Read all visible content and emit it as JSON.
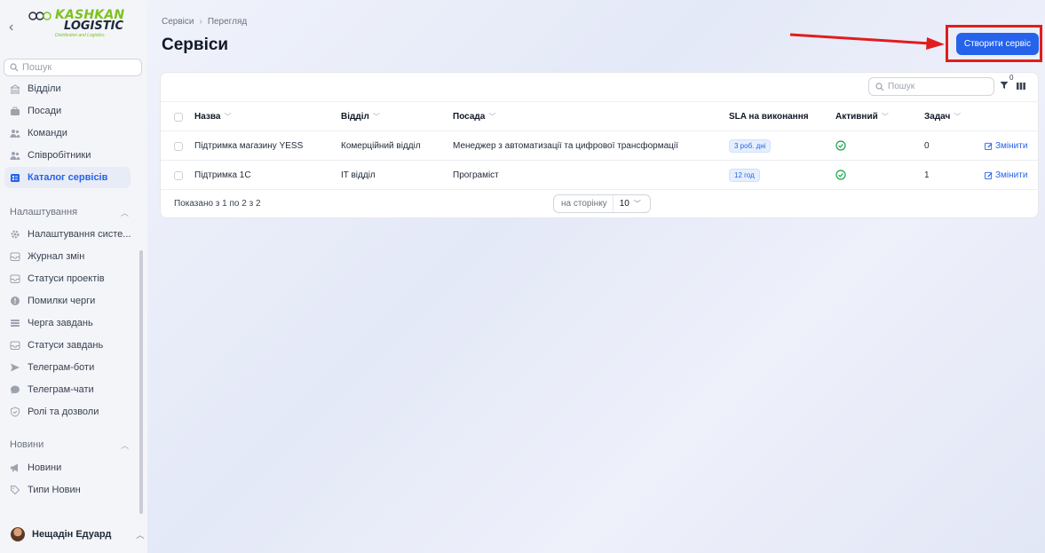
{
  "sidebar": {
    "logo_line1": "KASHKAN",
    "logo_line2": "LOGISTIC",
    "logo_tagline": "Distribution and Logistics",
    "search_placeholder": "Пошук",
    "items": [
      {
        "label": "Відділи",
        "icon": "building-icon"
      },
      {
        "label": "Посади",
        "icon": "briefcase-icon"
      },
      {
        "label": "Команди",
        "icon": "users-icon"
      },
      {
        "label": "Співробітники",
        "icon": "users-icon"
      },
      {
        "label": "Каталог сервісів",
        "icon": "catalog-icon",
        "active": true
      }
    ],
    "settings_group": "Налаштування",
    "settings_items": [
      {
        "label": "Налаштування систе...",
        "icon": "gear-icon"
      },
      {
        "label": "Журнал змін",
        "icon": "inbox-icon"
      },
      {
        "label": "Статуси проектів",
        "icon": "inbox-icon"
      },
      {
        "label": "Помилки черги",
        "icon": "alert-icon"
      },
      {
        "label": "Черга завдань",
        "icon": "queue-icon"
      },
      {
        "label": "Статуси завдань",
        "icon": "inbox-icon"
      },
      {
        "label": "Телеграм-боти",
        "icon": "send-icon"
      },
      {
        "label": "Телеграм-чати",
        "icon": "chat-icon"
      },
      {
        "label": "Ролі та дозволи",
        "icon": "shield-icon"
      }
    ],
    "news_group": "Новини",
    "news_items": [
      {
        "label": "Новини",
        "icon": "megaphone-icon"
      },
      {
        "label": "Типи Новин",
        "icon": "tag-icon"
      }
    ],
    "user_name": "Нещадін Едуард"
  },
  "header": {
    "breadcrumb": [
      "Сервіси",
      "Перегляд"
    ],
    "breadcrumb_sep": "›",
    "title": "Сервіси",
    "create_button": "Створити сервіс"
  },
  "table": {
    "search_placeholder": "Пошук",
    "filter_count": "0",
    "columns": [
      "Назва",
      "Відділ",
      "Посада",
      "SLA на виконання",
      "Активний",
      "Задач"
    ],
    "rows": [
      {
        "name": "Підтримка магазину YESS",
        "dept": "Комерційний відділ",
        "position": "Менеджер з автоматизації та цифрової трансформації",
        "sla": "3 роб. дні",
        "active": true,
        "tasks": "0",
        "edit": "Змінити"
      },
      {
        "name": "Підтримка 1С",
        "dept": "IT відділ",
        "position": "Програміст",
        "sla": "12 год",
        "active": true,
        "tasks": "1",
        "edit": "Змінити"
      }
    ],
    "showing": "Показано з 1 по 2 з 2",
    "per_page_label": "на сторінку",
    "per_page_value": "10"
  },
  "colors": {
    "accent": "#2563eb",
    "highlight_red": "#e11d1d",
    "logo_green": "#7cc21c",
    "active_green": "#16a34a"
  }
}
